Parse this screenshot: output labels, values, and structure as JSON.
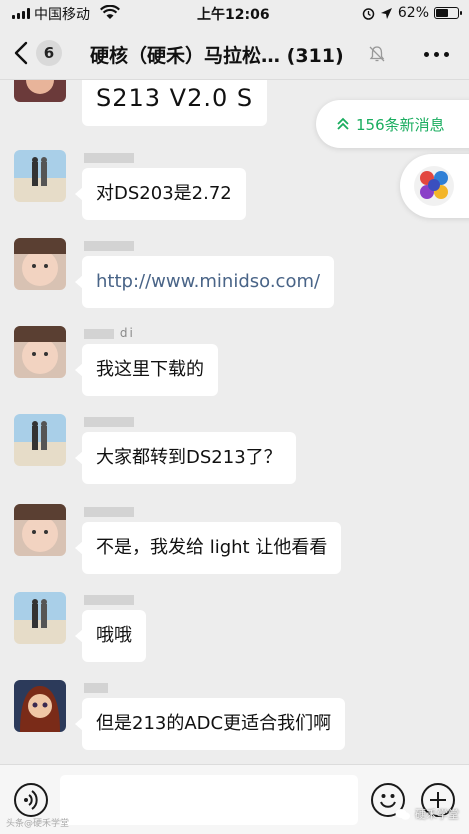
{
  "status_bar": {
    "carrier": "中国移动",
    "time": "上午12:06",
    "battery": "62%",
    "battery_level": 0.62
  },
  "nav": {
    "back_badge": "6",
    "title": "硬核（硬禾）马拉松…",
    "member_count": "(311)"
  },
  "new_messages": {
    "label": "156条新消息"
  },
  "messages": [
    {
      "sender": "",
      "text": "S213 V2.0 S",
      "type": "text",
      "avatar": "girl-avatar"
    },
    {
      "sender": "",
      "text": "对DS203是2.72",
      "type": "text",
      "avatar": "beach-couple-avatar"
    },
    {
      "sender": "",
      "text": "http://www.minidso.com/",
      "type": "link",
      "avatar": "child-avatar"
    },
    {
      "sender": "di",
      "text": "我这里下载的",
      "type": "text",
      "avatar": "child-avatar"
    },
    {
      "sender": "",
      "text": "大家都转到DS213了？",
      "type": "text",
      "avatar": "beach-couple-avatar"
    },
    {
      "sender": "",
      "text": "不是，我发给 light 让他看看",
      "type": "text",
      "avatar": "child-avatar"
    },
    {
      "sender": "",
      "text": "哦哦",
      "type": "text",
      "avatar": "beach-couple-avatar"
    },
    {
      "sender": "",
      "text": "但是213的ADC更适合我们啊",
      "type": "text",
      "avatar": "cartoon-girl-avatar"
    }
  ],
  "watermark": {
    "label": "硬禾学堂",
    "left_label": "头条@硬禾学堂"
  },
  "colors": {
    "background": "#ededed",
    "bubble": "#ffffff",
    "link": "#496487",
    "accent_green": "#1aad5f"
  }
}
